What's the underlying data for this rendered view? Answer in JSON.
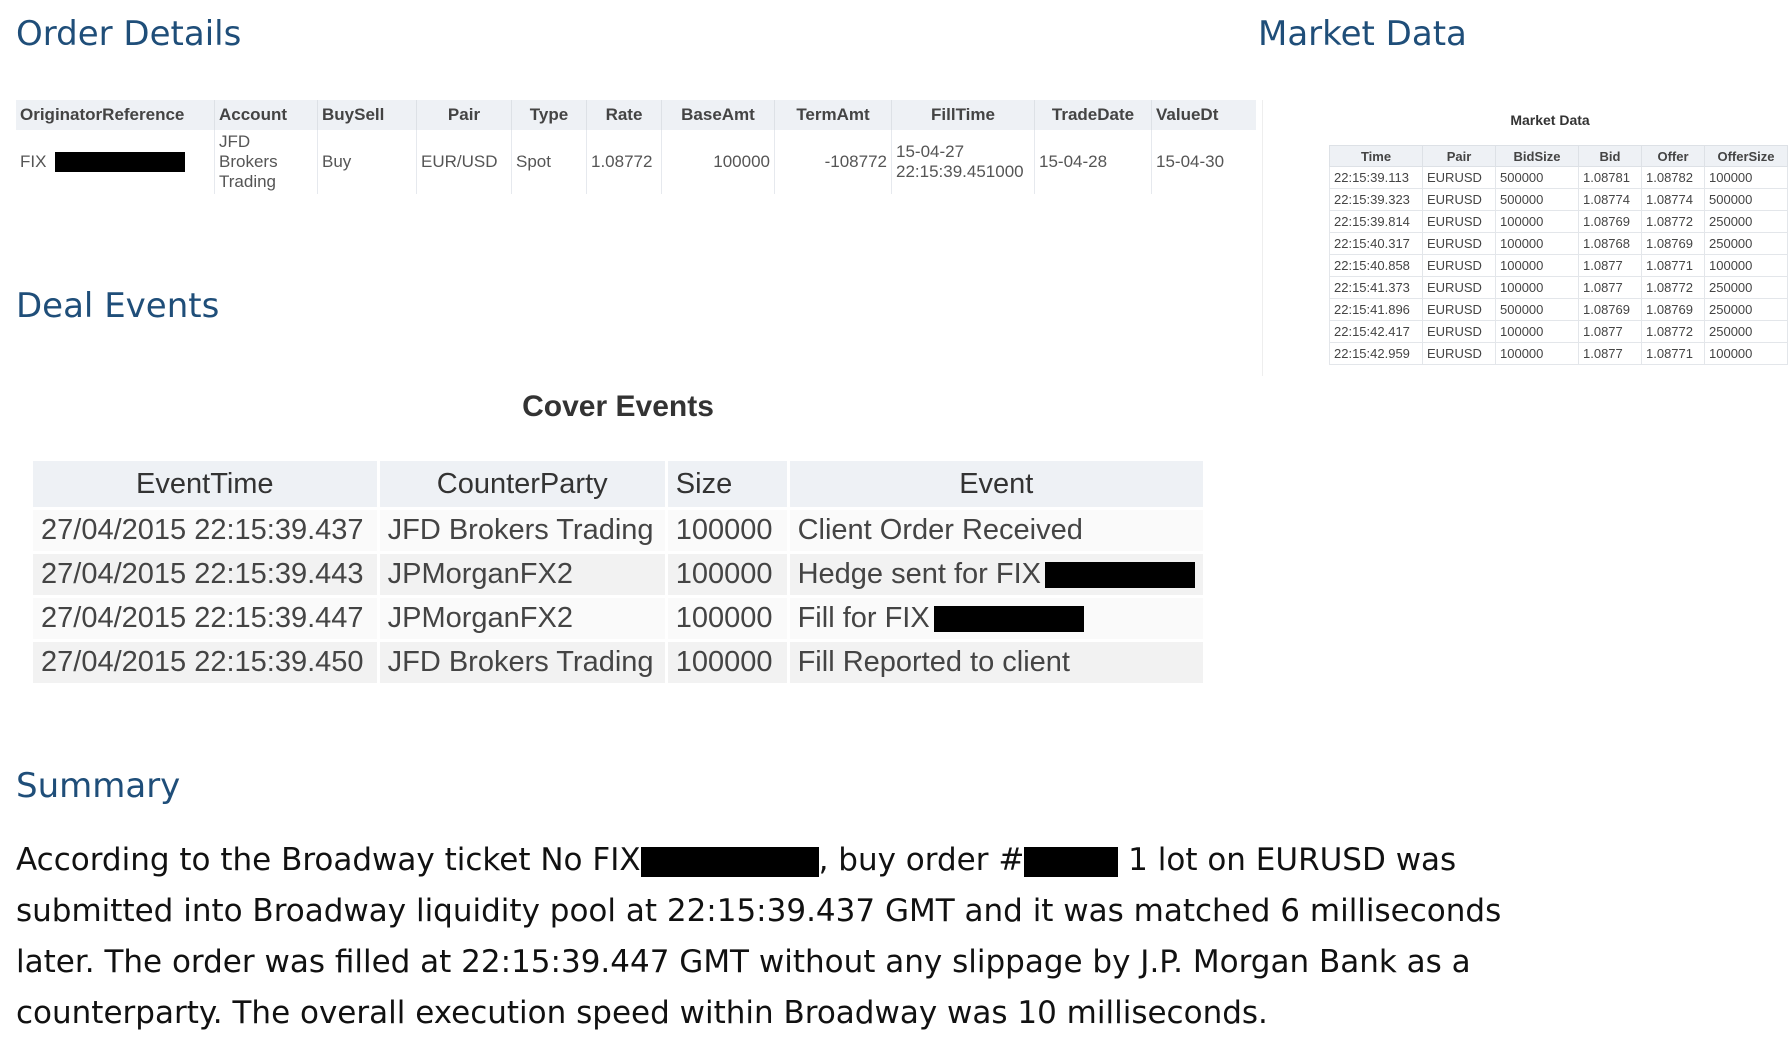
{
  "order_details": {
    "title": "Order Details",
    "columns": [
      "OriginatorReference",
      "Account",
      "BuySell",
      "Pair",
      "Type",
      "Rate",
      "BaseAmt",
      "TermAmt",
      "FillTime",
      "TradeDate",
      "ValueDt"
    ],
    "row": {
      "originator_reference": "FIX",
      "account_line1": "JFD",
      "account_line2": "Brokers",
      "account_line3": "Trading",
      "buy_sell": "Buy",
      "pair": "EUR/USD",
      "type": "Spot",
      "rate": "1.08772",
      "base_amt": "100000",
      "term_amt": "-108772",
      "fill_time_date": "15-04-27",
      "fill_time_time": "22:15:39.451000",
      "trade_date": "15-04-28",
      "value_dt": "15-04-30"
    }
  },
  "market_data": {
    "title": "Market Data",
    "caption": "Market Data",
    "columns": [
      "Time",
      "Pair",
      "BidSize",
      "Bid",
      "Offer",
      "OfferSize"
    ],
    "rows": [
      [
        "22:15:39.113",
        "EURUSD",
        "500000",
        "1.08781",
        "1.08782",
        "100000"
      ],
      [
        "22:15:39.323",
        "EURUSD",
        "500000",
        "1.08774",
        "1.08774",
        "500000"
      ],
      [
        "22:15:39.814",
        "EURUSD",
        "100000",
        "1.08769",
        "1.08772",
        "250000"
      ],
      [
        "22:15:40.317",
        "EURUSD",
        "100000",
        "1.08768",
        "1.08769",
        "250000"
      ],
      [
        "22:15:40.858",
        "EURUSD",
        "100000",
        "1.0877",
        "1.08771",
        "100000"
      ],
      [
        "22:15:41.373",
        "EURUSD",
        "100000",
        "1.0877",
        "1.08772",
        "250000"
      ],
      [
        "22:15:41.896",
        "EURUSD",
        "500000",
        "1.08769",
        "1.08769",
        "250000"
      ],
      [
        "22:15:42.417",
        "EURUSD",
        "100000",
        "1.0877",
        "1.08772",
        "250000"
      ],
      [
        "22:15:42.959",
        "EURUSD",
        "100000",
        "1.0877",
        "1.08771",
        "100000"
      ]
    ]
  },
  "deal_events": {
    "title": "Deal Events",
    "cover_caption": "Cover Events",
    "columns": [
      "EventTime",
      "CounterParty",
      "Size",
      "Event"
    ],
    "rows": [
      {
        "time": "27/04/2015 22:15:39.437",
        "counterparty": "JFD Brokers Trading",
        "size": "100000",
        "event": "Client Order Received",
        "redacted": false
      },
      {
        "time": "27/04/2015 22:15:39.443",
        "counterparty": "JPMorganFX2",
        "size": "100000",
        "event": "Hedge sent for FIX",
        "redacted": true
      },
      {
        "time": "27/04/2015 22:15:39.447",
        "counterparty": "JPMorganFX2",
        "size": "100000",
        "event": "Fill for FIX",
        "redacted": true
      },
      {
        "time": "27/04/2015 22:15:39.450",
        "counterparty": "JFD Brokers Trading",
        "size": "100000",
        "event": "Fill Reported to client",
        "redacted": false
      }
    ]
  },
  "summary": {
    "title": "Summary",
    "part1": "According to the Broadway ticket No  FIX",
    "part2": ", buy order #",
    "part3": " 1 lot on EURUSD was submitted into Broadway liquidity pool at 22:15:39.437 GMT and it was matched 6 milliseconds later. The order was filled at 22:15:39.447 GMT without any slippage by J.P. Morgan Bank as a counterparty. The overall execution speed within Broadway was 10 milliseconds."
  }
}
